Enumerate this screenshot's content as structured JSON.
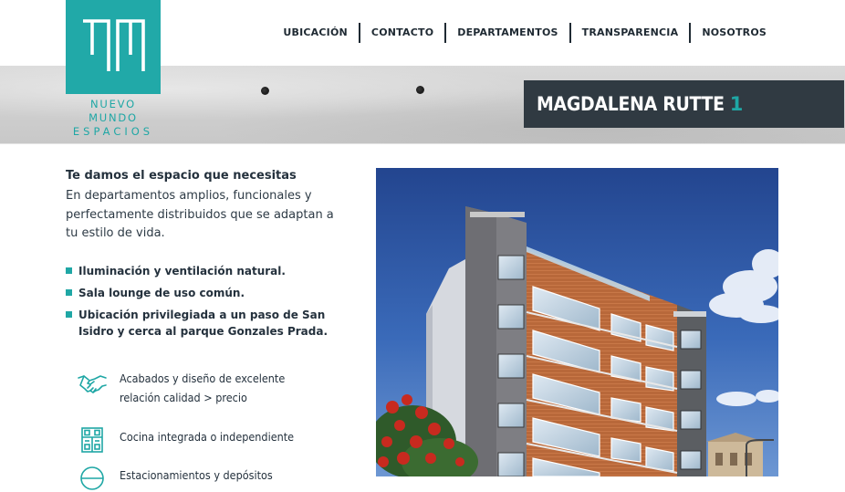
{
  "brand": {
    "line1": "NUEVO MUNDO",
    "line2": "ESPACIOS",
    "color": "#21a9a8"
  },
  "nav": {
    "items": [
      "UBICACIÓN",
      "CONTACTO",
      "DEPARTAMENTOS",
      "TRANSPARENCIA",
      "NOSOTROS"
    ]
  },
  "project": {
    "name": "MAGDALENA RUTTE",
    "number": "1"
  },
  "intro": {
    "title": "Te damos el espacio que necesitas",
    "body": "En departamentos amplios, funcionales y perfectamente distribuidos que se adaptan a tu estilo de vida."
  },
  "features": [
    "Iluminación y ventilación natural.",
    "Sala lounge de uso común.",
    "Ubicación privilegiada a un paso de San Isidro y cerca al parque Gonzales Prada."
  ],
  "amenities": [
    {
      "icon": "handshake-icon",
      "line1": "Acabados y diseño de excelente",
      "line2": "relación calidad > precio"
    },
    {
      "icon": "kitchen-icon",
      "line1": "Cocina integrada o independiente",
      "line2": ""
    },
    {
      "icon": "parking-icon",
      "line1": "Estacionamientos y depósitos",
      "line2": ""
    }
  ],
  "colors": {
    "accent": "#1fa7a5",
    "dark": "#303a42",
    "text": "#24313d"
  }
}
